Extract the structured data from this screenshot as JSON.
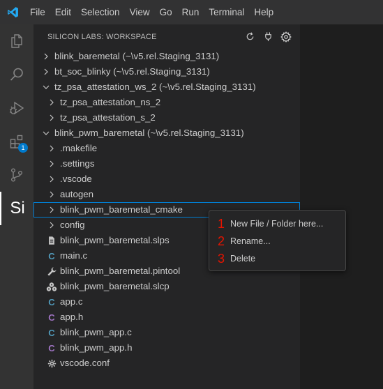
{
  "menubar": {
    "items": [
      "File",
      "Edit",
      "Selection",
      "View",
      "Go",
      "Run",
      "Terminal",
      "Help"
    ]
  },
  "activitybar": {
    "items": [
      {
        "name": "explorer-icon"
      },
      {
        "name": "search-icon"
      },
      {
        "name": "run-debug-icon"
      },
      {
        "name": "extensions-icon",
        "badge": "1"
      },
      {
        "name": "source-control-icon"
      },
      {
        "name": "silicon-labs-icon",
        "text": "Si"
      }
    ]
  },
  "sidebar": {
    "title": "SILICON LABS: WORKSPACE",
    "actions": [
      "refresh-icon",
      "plug-icon",
      "gear-icon"
    ],
    "tree": [
      {
        "label": "blink_baremetal (~\\v5.rel.Staging_3131)",
        "level": 0,
        "twisty": "right",
        "icon": ""
      },
      {
        "label": "bt_soc_blinky (~\\v5.rel.Staging_3131)",
        "level": 0,
        "twisty": "right",
        "icon": ""
      },
      {
        "label": "tz_psa_attestation_ws_2 (~\\v5.rel.Staging_3131)",
        "level": 0,
        "twisty": "down",
        "icon": ""
      },
      {
        "label": "tz_psa_attestation_ns_2",
        "level": 1,
        "twisty": "right",
        "icon": ""
      },
      {
        "label": "tz_psa_attestation_s_2",
        "level": 1,
        "twisty": "right",
        "icon": ""
      },
      {
        "label": "blink_pwm_baremetal (~\\v5.rel.Staging_3131)",
        "level": 0,
        "twisty": "down",
        "icon": ""
      },
      {
        "label": ".makefile",
        "level": 1,
        "twisty": "right",
        "icon": ""
      },
      {
        "label": ".settings",
        "level": 1,
        "twisty": "right",
        "icon": ""
      },
      {
        "label": ".vscode",
        "level": 1,
        "twisty": "right",
        "icon": ""
      },
      {
        "label": "autogen",
        "level": 1,
        "twisty": "right",
        "icon": ""
      },
      {
        "label": "blink_pwm_baremetal_cmake",
        "level": 1,
        "twisty": "right",
        "icon": "",
        "selected": true
      },
      {
        "label": "config",
        "level": 1,
        "twisty": "right",
        "icon": ""
      },
      {
        "label": "blink_pwm_baremetal.slps",
        "level": 1,
        "twisty": "",
        "icon": "file"
      },
      {
        "label": "main.c",
        "level": 1,
        "twisty": "",
        "icon": "c"
      },
      {
        "label": "blink_pwm_baremetal.pintool",
        "level": 1,
        "twisty": "",
        "icon": "wrench"
      },
      {
        "label": "blink_pwm_baremetal.slcp",
        "level": 1,
        "twisty": "",
        "icon": "components"
      },
      {
        "label": "app.c",
        "level": 1,
        "twisty": "",
        "icon": "c"
      },
      {
        "label": "app.h",
        "level": 1,
        "twisty": "",
        "icon": "h"
      },
      {
        "label": "blink_pwm_app.c",
        "level": 1,
        "twisty": "",
        "icon": "c"
      },
      {
        "label": "blink_pwm_app.h",
        "level": 1,
        "twisty": "",
        "icon": "h"
      },
      {
        "label": "vscode.conf",
        "level": 1,
        "twisty": "",
        "icon": "gear"
      }
    ]
  },
  "context_menu": {
    "items": [
      {
        "num": "1",
        "label": "New File / Folder here..."
      },
      {
        "num": "2",
        "label": "Rename..."
      },
      {
        "num": "3",
        "label": "Delete"
      }
    ]
  },
  "colors": {
    "c_file": "#519aba",
    "h_file": "#a074c4",
    "annotation_numbers": "#e51400",
    "selection_outline": "#007fd4"
  }
}
